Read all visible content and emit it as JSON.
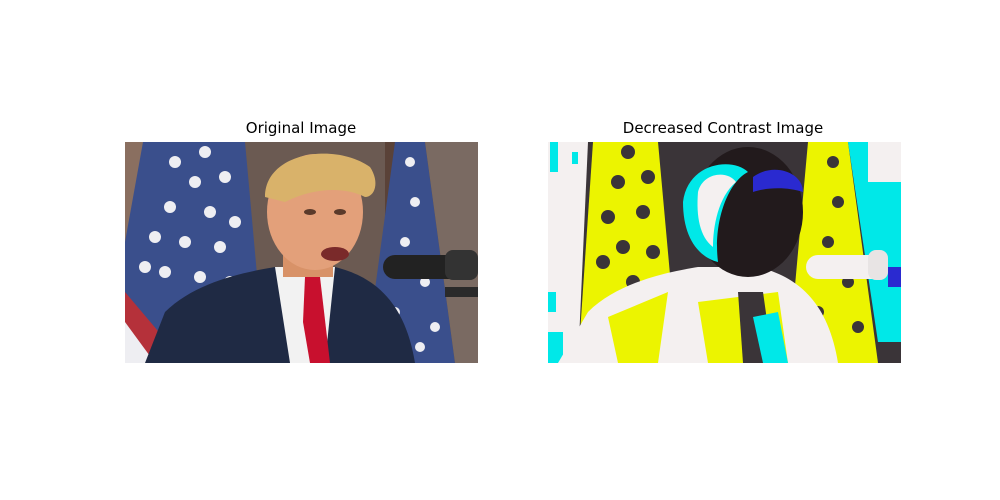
{
  "panels": [
    {
      "title": "Original Image",
      "image": "original-photo",
      "palette": {
        "flag_blue": "#3a4f8c",
        "flag_red": "#b5313a",
        "flag_white": "#eeeef2",
        "background": "#6b5a52",
        "suit": "#1f2a44",
        "shirt": "#f2f2f2",
        "tie": "#c8102e",
        "skin": "#e3a07a",
        "hair": "#d9b26a",
        "microphone": "#222222"
      }
    },
    {
      "title": "Decreased Contrast Image",
      "image": "altered-photo",
      "palette": {
        "yellow": "#ecf400",
        "cyan": "#00e8e8",
        "white": "#f4f0f0",
        "dark": "#3a3438",
        "blue_accent": "#2a2ad0",
        "shadow": "#221a1c"
      }
    }
  ]
}
